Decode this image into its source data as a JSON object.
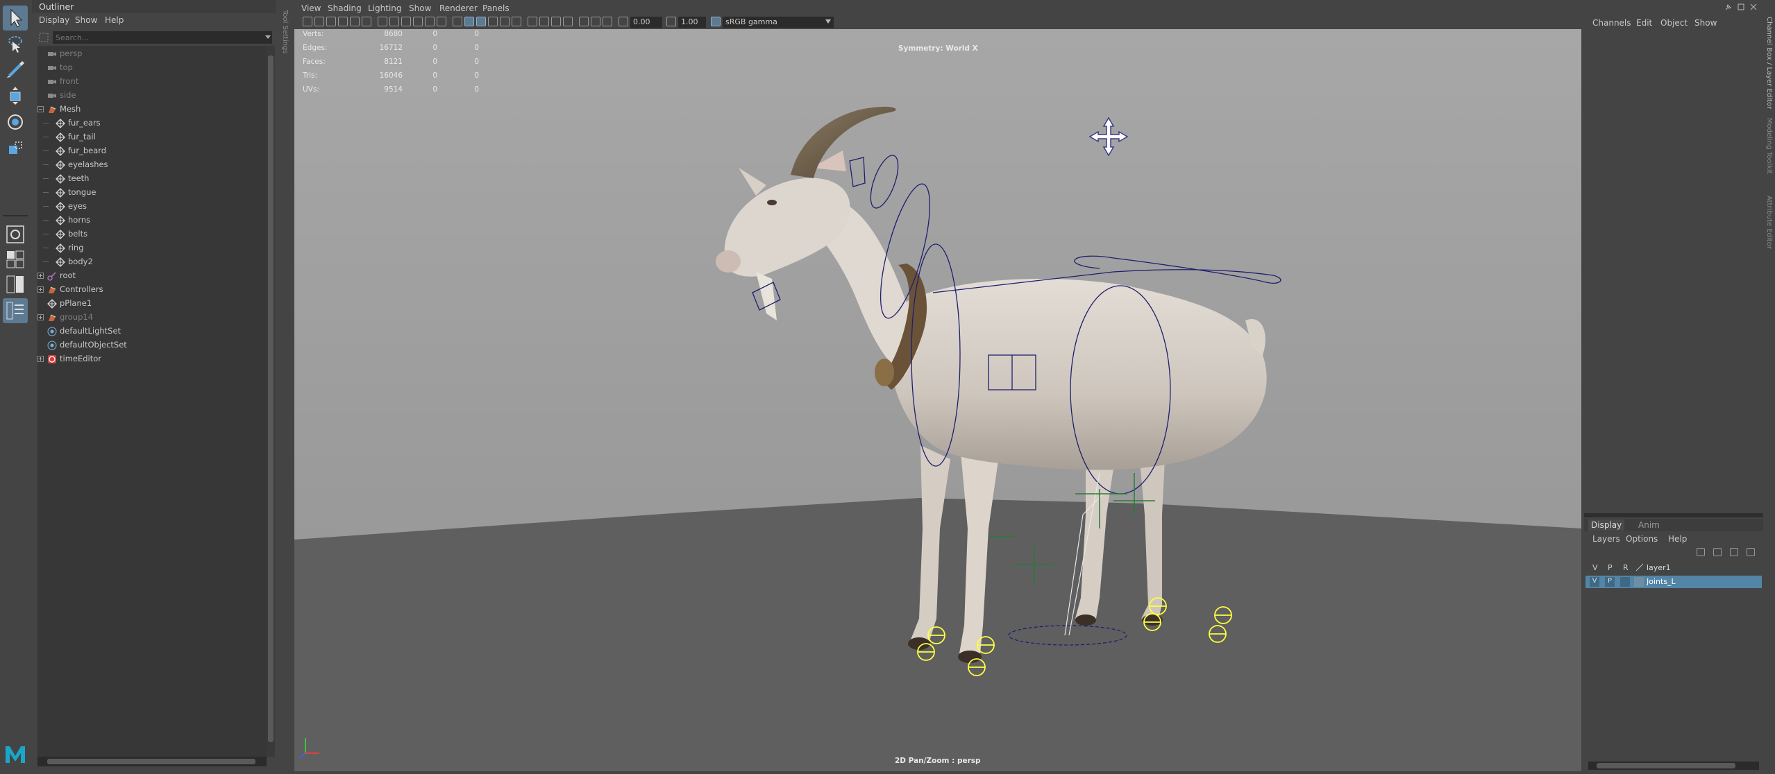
{
  "outliner": {
    "title": "Outliner",
    "menu": [
      "Display",
      "Show",
      "Help"
    ],
    "search_placeholder": "Search...",
    "items": [
      {
        "label": "persp",
        "type": "camera",
        "dim": true,
        "indent": 1
      },
      {
        "label": "top",
        "type": "camera",
        "dim": true,
        "indent": 1
      },
      {
        "label": "front",
        "type": "camera",
        "dim": true,
        "indent": 1
      },
      {
        "label": "side",
        "type": "camera",
        "dim": true,
        "indent": 1
      },
      {
        "label": "Mesh",
        "type": "group",
        "dim": false,
        "indent": 1,
        "expander": "open"
      },
      {
        "label": "fur_ears",
        "type": "mesh",
        "dim": false,
        "indent": 2
      },
      {
        "label": "fur_tail",
        "type": "mesh",
        "dim": false,
        "indent": 2
      },
      {
        "label": "fur_beard",
        "type": "mesh",
        "dim": false,
        "indent": 2
      },
      {
        "label": "eyelashes",
        "type": "mesh",
        "dim": false,
        "indent": 2
      },
      {
        "label": "teeth",
        "type": "mesh",
        "dim": false,
        "indent": 2
      },
      {
        "label": "tongue",
        "type": "mesh",
        "dim": false,
        "indent": 2
      },
      {
        "label": "eyes",
        "type": "mesh",
        "dim": false,
        "indent": 2
      },
      {
        "label": "horns",
        "type": "mesh",
        "dim": false,
        "indent": 2
      },
      {
        "label": "belts",
        "type": "mesh",
        "dim": false,
        "indent": 2
      },
      {
        "label": "ring",
        "type": "mesh",
        "dim": false,
        "indent": 2
      },
      {
        "label": "body2",
        "type": "mesh",
        "dim": false,
        "indent": 2
      },
      {
        "label": "root",
        "type": "joint",
        "dim": false,
        "indent": 1,
        "expander": "closed"
      },
      {
        "label": "Controllers",
        "type": "group",
        "dim": false,
        "indent": 1,
        "expander": "closed"
      },
      {
        "label": "pPlane1",
        "type": "mesh",
        "dim": false,
        "indent": 1
      },
      {
        "label": "group14",
        "type": "group",
        "dim": true,
        "indent": 1,
        "expander": "closed"
      },
      {
        "label": "defaultLightSet",
        "type": "set",
        "dim": false,
        "indent": 1
      },
      {
        "label": "defaultObjectSet",
        "type": "set",
        "dim": false,
        "indent": 1
      },
      {
        "label": "timeEditor",
        "type": "timeeditor",
        "dim": false,
        "indent": 1,
        "expander": "closed"
      }
    ]
  },
  "tool_settings_label": "Tool Settings",
  "viewport": {
    "menu": [
      "View",
      "Shading",
      "Lighting",
      "Show",
      "Renderer",
      "Panels"
    ],
    "exposure": "0.00",
    "gamma": "1.00",
    "color_space": "sRGB gamma",
    "symmetry": "Symmetry: World X",
    "camera_label": "2D Pan/Zoom : persp",
    "hud": [
      {
        "label": "Verts:",
        "a": "8680",
        "b": "0",
        "c": "0"
      },
      {
        "label": "Edges:",
        "a": "16712",
        "b": "0",
        "c": "0"
      },
      {
        "label": "Faces:",
        "a": "8121",
        "b": "0",
        "c": "0"
      },
      {
        "label": "Tris:",
        "a": "16046",
        "b": "0",
        "c": "0"
      },
      {
        "label": "UVs:",
        "a": "9514",
        "b": "0",
        "c": "0"
      }
    ]
  },
  "channel_box": {
    "menu": [
      "Channels",
      "Edit",
      "Object",
      "Show"
    ]
  },
  "layer_editor": {
    "tabs": [
      "Display",
      "Anim"
    ],
    "menu": [
      "Layers",
      "Options",
      "Help"
    ],
    "columns": [
      "V",
      "P",
      "R"
    ],
    "layers": [
      {
        "name": "layer1",
        "v": "",
        "p": "",
        "selected": false
      },
      {
        "name": "Joints_L",
        "v": "V",
        "p": "P",
        "selected": true
      }
    ]
  },
  "right_strip": [
    "Channel Box / Layer Editor",
    "Modeling Toolkit",
    "Attribute Editor"
  ],
  "colors": {
    "accent": "#5d7a93",
    "selected_row": "#5285a6",
    "viewport_bg": "#a0a0a0",
    "panel_bg": "#444444",
    "control_curve": "#1e1e6e",
    "joint_yellow": "#ffff40"
  }
}
